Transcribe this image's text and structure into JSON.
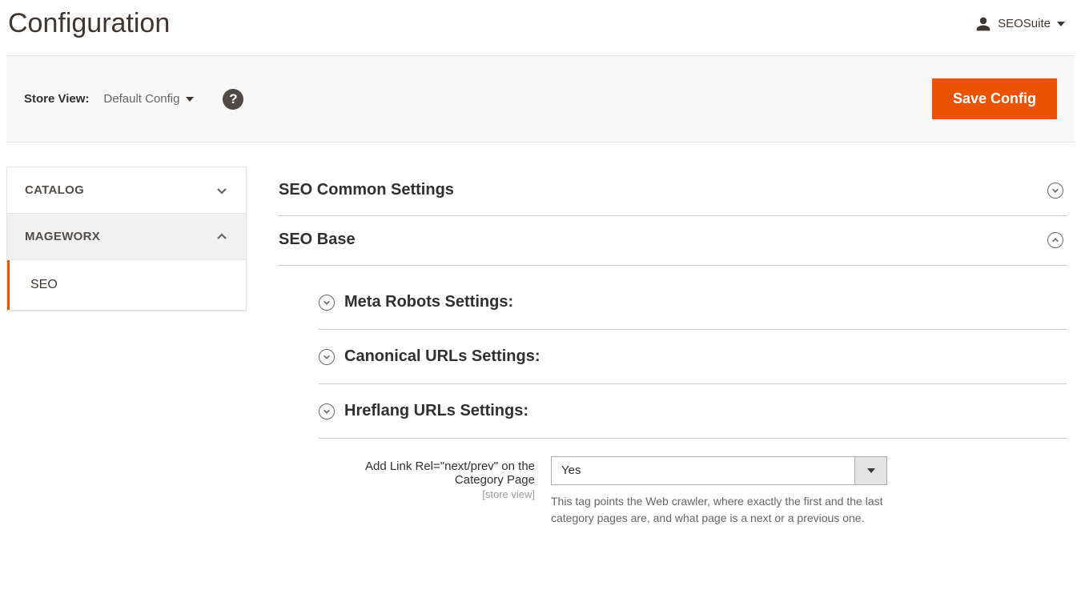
{
  "header": {
    "title": "Configuration",
    "user": "SEOSuite"
  },
  "toolbar": {
    "store_view_label": "Store View:",
    "store_view_value": "Default Config",
    "save_label": "Save Config"
  },
  "sidebar": {
    "sections": [
      {
        "label": "CATALOG",
        "expanded": false
      },
      {
        "label": "MAGEWORX",
        "expanded": true,
        "items": [
          {
            "label": "SEO",
            "active": true
          }
        ]
      }
    ]
  },
  "config": {
    "sections": [
      {
        "title": "SEO Common Settings",
        "expanded": false
      },
      {
        "title": "SEO Base",
        "expanded": true,
        "subsections": [
          {
            "title": "Meta Robots Settings:"
          },
          {
            "title": "Canonical URLs Settings:"
          },
          {
            "title": "Hreflang URLs Settings:"
          }
        ],
        "field": {
          "label": "Add Link Rel=\"next/prev\" on the Category Page",
          "scope": "[store view]",
          "value": "Yes",
          "hint": "This tag points the Web crawler, where exactly the first and the last category pages are, and what page is a next or a previous one."
        }
      }
    ]
  }
}
